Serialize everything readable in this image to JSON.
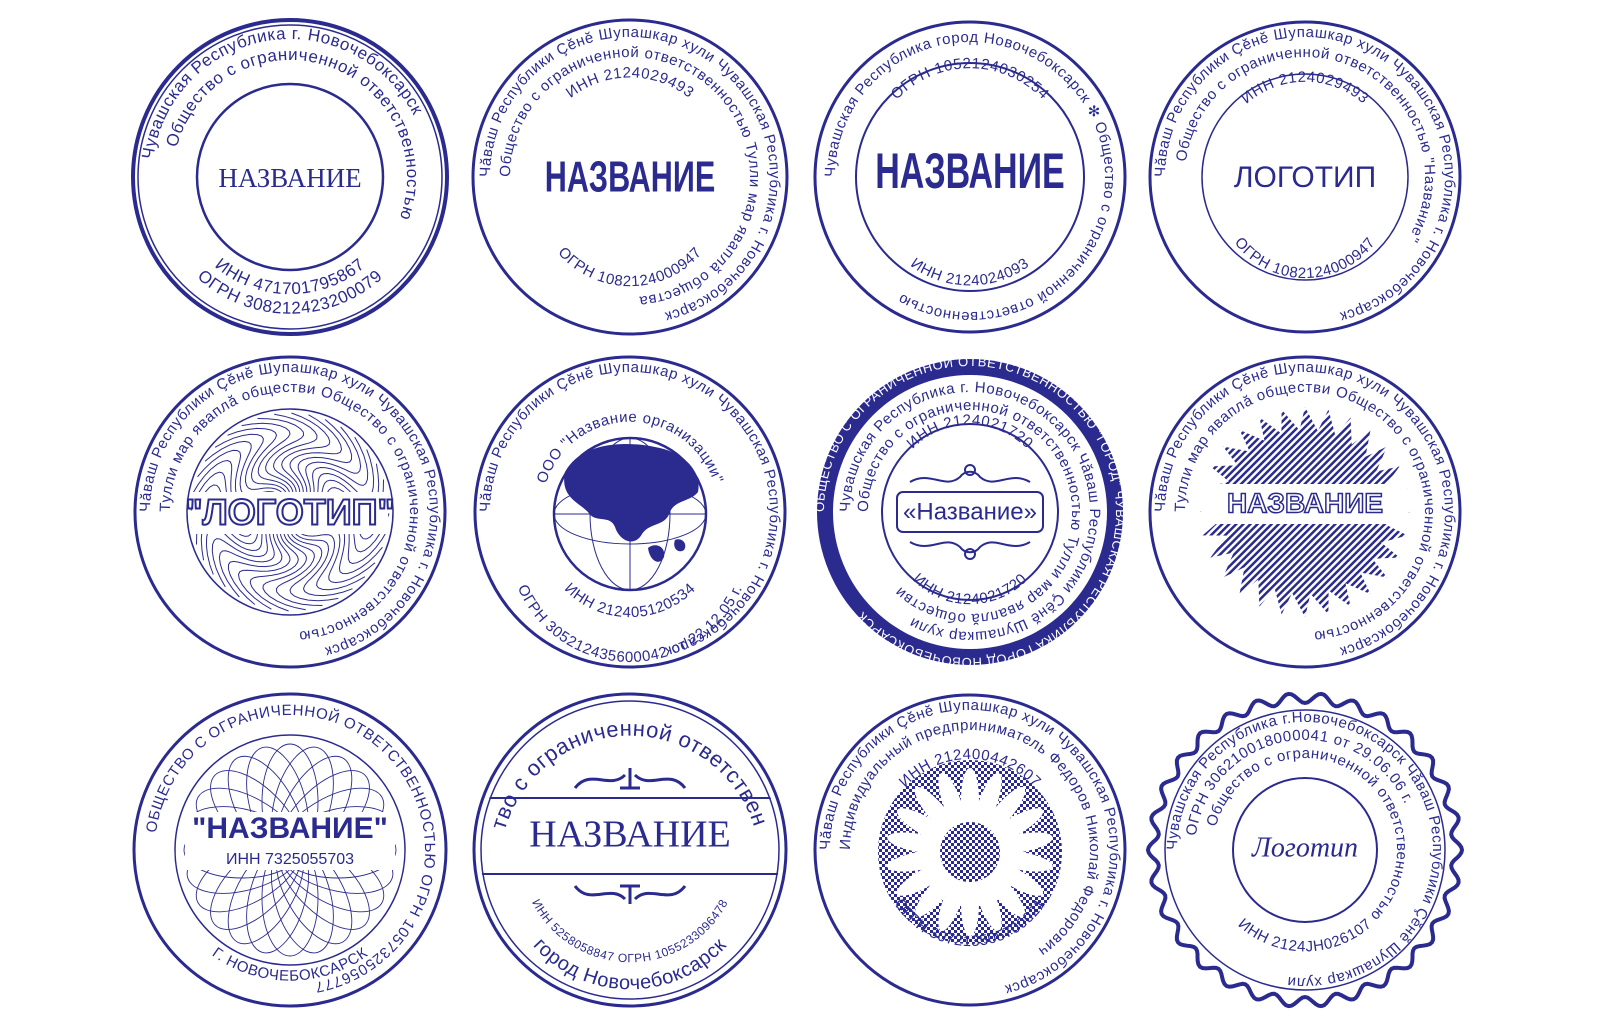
{
  "ink": "#2b2b8f",
  "stamps": [
    {
      "outer": "Чувашская Республика г. Новочебоксарск",
      "inner": "Общество с ограниченной ответственностью",
      "bottom1": "ИНН 471701795867",
      "bottom2": "ОГРН 308212423200079",
      "center": "НАЗВАНИЕ"
    },
    {
      "outer": "Чăваш Республики Çĕнĕ Шупашкар хули Чувашская Республика г. Новочебоксарск",
      "inner": "Общество с ограниченной ответственностью Тулли мар яваплă общества",
      "top": "ИНН 2124029493",
      "bottom": "ОГРН 1082124000947",
      "center": "НАЗВАНИЕ"
    },
    {
      "outer": "Чувашская Республика город Новочебоксарск ✻ Общество с ограниченной ответственностью",
      "top": "ОГРН 1052124030254",
      "bottom": "ИНН 2124024093",
      "center": "НАЗВАНИЕ"
    },
    {
      "outer": "Чăваш Республики Çĕнĕ Шупашкар хули Чувашская Республика г. Новочебоксарск",
      "inner": "Общество с ограниченной ответственностью \"Название\"",
      "top": "ИНН 2124029493",
      "bottom": "ОГРН 1082124000947",
      "center": "ЛОГОТИП"
    },
    {
      "outer": "Чăваш Республики Çĕнĕ Шупашкар хули Чувашская Республика г. Новочебоксарск",
      "inner": "Тулли мар яваплă обществи Общество с ограниченной ответственностью",
      "center": "\"ЛОГОТИП\""
    },
    {
      "outer": "Чăваш Республики Çĕнĕ Шупашкар хули Чувашская Республика г. Новочебоксарск",
      "inner": "ООО \"Название организации\"",
      "bottom1": "ИНН 2124051205З4",
      "bottom2": "ОГРН 305212435600042 от 22.12.05 г."
    },
    {
      "band": "ОБЩЕСТВО С ОГРАНИЧЕННОЙ ОТВЕТСТВЕННОСТЬЮ \"ГОРОД\" ЧУВАШСКАЯ РЕСПУБЛИКА ГОРОД НОВОЧЕБОКСАРСК",
      "outer": "Чувашская Республика г. Новочебоксарск Чăваш Республики Çĕнĕ Шупашкар хули",
      "inner": "Общество с ограниченной ответственностью Тулли мар яваплă обществи",
      "top": "ИНН 2124021720",
      "bottom": "ИНН 2124021720",
      "center": "«Название»"
    },
    {
      "outer": "Чăваш Республики Çĕнĕ Шупашкар хули Чувашская Республика г. Новочебоксарск",
      "inner": "Тулли мар яваплă обществи Общество с ограниченной ответственностью",
      "center": "НАЗВАНИЕ"
    },
    {
      "outer": "ОБЩЕСТВО С ОГРАНИЧЕННОЙ ОТВЕТСТВЕННОСТЬЮ ОГРН 1057325056777",
      "bottom": "Г. НОВОЧЕБОКСАРСК",
      "center": "\"НАЗВАНИЕ\"",
      "sub": "ИНН 7325055703"
    },
    {
      "top": "Общество с ограниченной ответственностью",
      "bottom1": "ИНН 5258058847 ОГРН 1055233096478",
      "bottom2": "город Новочебоксарск",
      "center": "НАЗВАНИЕ"
    },
    {
      "outer": "Чăваш Республики Çĕнĕ Шупашкар хули Чувашская Республика г. Новочебоксарск",
      "inner": "Индивидуальный предприниматель Федоров Николай Федорович",
      "top": "ИНН 212400442607",
      "bottom": "ОГРН 307213505700021"
    },
    {
      "outer": "Чувашская Республика г.Новочебоксарск Чăваш Республики Çĕнĕ Шупашкар хули",
      "line2": "ОГРН 306210018000041 от 29.06.06 г.",
      "inner": "Общество с ограниченной ответственностью",
      "bottom": "ИНН 2124JH026107",
      "center": "Логотип"
    }
  ]
}
